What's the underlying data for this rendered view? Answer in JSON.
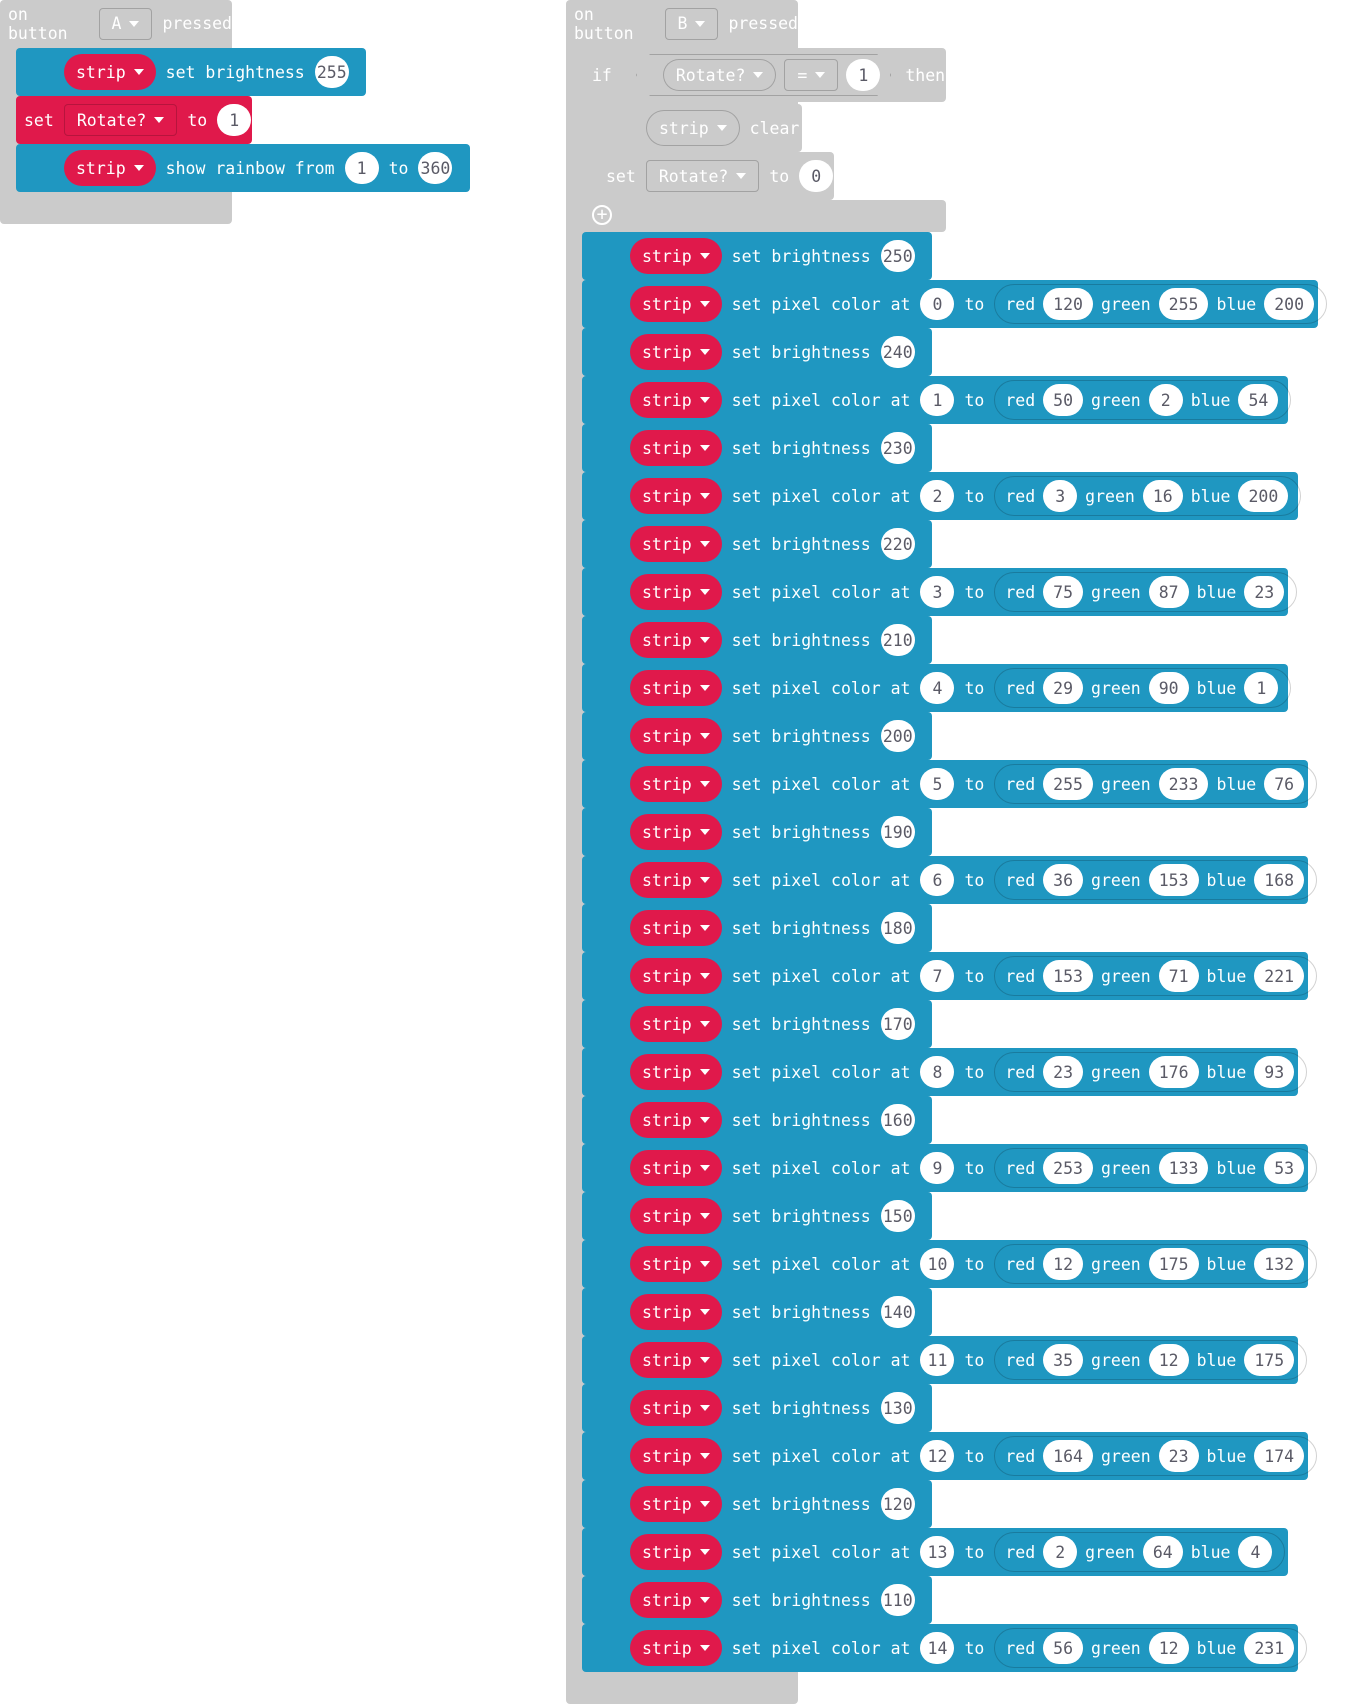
{
  "event_a": {
    "prefix": "on button",
    "button": "A",
    "suffix": "pressed",
    "blocks": {
      "b1": {
        "strip": "strip",
        "label": "set brightness",
        "value": "255"
      },
      "b2": {
        "set": "set",
        "var": "Rotate?",
        "to": "to",
        "value": "1"
      },
      "b3": {
        "strip": "strip",
        "label": "show rainbow from",
        "from": "1",
        "to": "to",
        "to_value": "360"
      }
    }
  },
  "event_b": {
    "prefix": "on button",
    "button": "B",
    "suffix": "pressed",
    "if": {
      "kw": "if",
      "var": "Rotate?",
      "op": "=",
      "value": "1",
      "then": "then"
    },
    "then_blocks": {
      "clear": {
        "strip": "strip",
        "label": "clear"
      },
      "set": {
        "set": "set",
        "var": "Rotate?",
        "to": "to",
        "value": "0"
      }
    },
    "strip_label": "strip",
    "brightness_label": "set brightness",
    "pixel_label": "set pixel color at",
    "to_label": "to",
    "red_label": "red",
    "green_label": "green",
    "blue_label": "blue",
    "steps": [
      {
        "brightness": "250",
        "index": "0",
        "red": "120",
        "green": "255",
        "blue": "200"
      },
      {
        "brightness": "240",
        "index": "1",
        "red": "50",
        "green": "2",
        "blue": "54"
      },
      {
        "brightness": "230",
        "index": "2",
        "red": "3",
        "green": "16",
        "blue": "200"
      },
      {
        "brightness": "220",
        "index": "3",
        "red": "75",
        "green": "87",
        "blue": "23"
      },
      {
        "brightness": "210",
        "index": "4",
        "red": "29",
        "green": "90",
        "blue": "1"
      },
      {
        "brightness": "200",
        "index": "5",
        "red": "255",
        "green": "233",
        "blue": "76"
      },
      {
        "brightness": "190",
        "index": "6",
        "red": "36",
        "green": "153",
        "blue": "168"
      },
      {
        "brightness": "180",
        "index": "7",
        "red": "153",
        "green": "71",
        "blue": "221"
      },
      {
        "brightness": "170",
        "index": "8",
        "red": "23",
        "green": "176",
        "blue": "93"
      },
      {
        "brightness": "160",
        "index": "9",
        "red": "253",
        "green": "133",
        "blue": "53"
      },
      {
        "brightness": "150",
        "index": "10",
        "red": "12",
        "green": "175",
        "blue": "132"
      },
      {
        "brightness": "140",
        "index": "11",
        "red": "35",
        "green": "12",
        "blue": "175"
      },
      {
        "brightness": "130",
        "index": "12",
        "red": "164",
        "green": "23",
        "blue": "174"
      },
      {
        "brightness": "120",
        "index": "13",
        "red": "2",
        "green": "64",
        "blue": "4"
      },
      {
        "brightness": "110",
        "index": "14",
        "red": "56",
        "green": "12",
        "blue": "231"
      }
    ]
  },
  "colors": {
    "neopixel": "#1f97c1",
    "variables": "#e0194b",
    "events": "#cbcbcb"
  }
}
